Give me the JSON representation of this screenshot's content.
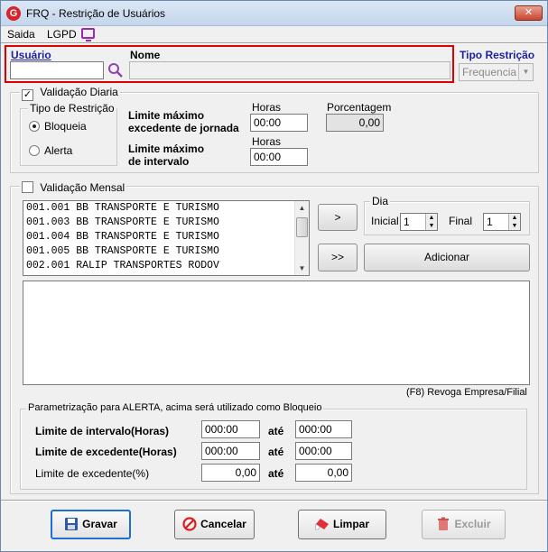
{
  "window": {
    "title": "FRQ - Restrição de Usuários",
    "app_icon_letter": "G",
    "close_label": "✕"
  },
  "menu": {
    "saida": "Saida",
    "lgpd": "LGPD"
  },
  "header": {
    "usuario_label": "Usuário",
    "usuario_value": "",
    "nome_label": "Nome",
    "nome_value": "",
    "tipo_restricao_label": "Tipo Restrição",
    "tipo_restricao_value": "Frequencia"
  },
  "validacao_diaria": {
    "label": "Validação Diaria",
    "checked": true,
    "tipo_restricao_group": "Tipo de Restrição",
    "options": [
      "Bloqueia",
      "Alerta"
    ],
    "selected": "Bloqueia",
    "limite_jornada_label_1": "Limite máximo",
    "limite_jornada_label_2": "excedente de jornada",
    "horas_label_1": "Horas",
    "limite_jornada_value": "00:00",
    "porcentagem_label": "Porcentagem",
    "porcentagem_value": "0,00",
    "limite_intervalo_label_1": "Limite máximo",
    "limite_intervalo_label_2": "de intervalo",
    "horas_label_2": "Horas",
    "limite_intervalo_value": "00:00"
  },
  "validacao_mensal": {
    "label": "Validação Mensal",
    "checked": false,
    "companies": [
      "001.001 BB TRANSPORTE E TURISMO",
      "001.003 BB TRANSPORTE E TURISMO",
      "001.004 BB TRANSPORTE E TURISMO",
      "001.005 BB TRANSPORTE E TURISMO",
      "002.001 RALIP TRANSPORTES RODOV"
    ],
    "move_one_label": ">",
    "move_all_label": ">>",
    "dia_group": "Dia",
    "inicial_label": "Inicial",
    "inicial_value": "1",
    "final_label": "Final",
    "final_value": "1",
    "adicionar_label": "Adicionar",
    "revoga_hint": "(F8) Revoga Empresa/Filial"
  },
  "alerta": {
    "group_label": "Parametrização para ALERTA, acima será utilizado como  Bloqueio",
    "intervalo_label": "Limite de intervalo(Horas)",
    "intervalo_de": "000:00",
    "intervalo_ate": "000:00",
    "excedente_label": "Limite de excedente(Horas)",
    "excedente_de": "000:00",
    "excedente_ate": "000:00",
    "excedente_pct_label": "Limite de excedente(%)",
    "excedente_pct_de": "0,00",
    "excedente_pct_ate": "0,00",
    "ate_label": "até"
  },
  "footer": {
    "gravar": "Gravar",
    "cancelar": "Cancelar",
    "limpar": "Limpar",
    "excluir": "Excluir"
  },
  "colors": {
    "highlight": "#e00000",
    "title_blue": "#1f1f9e",
    "default_border": "#1e6fd0"
  }
}
